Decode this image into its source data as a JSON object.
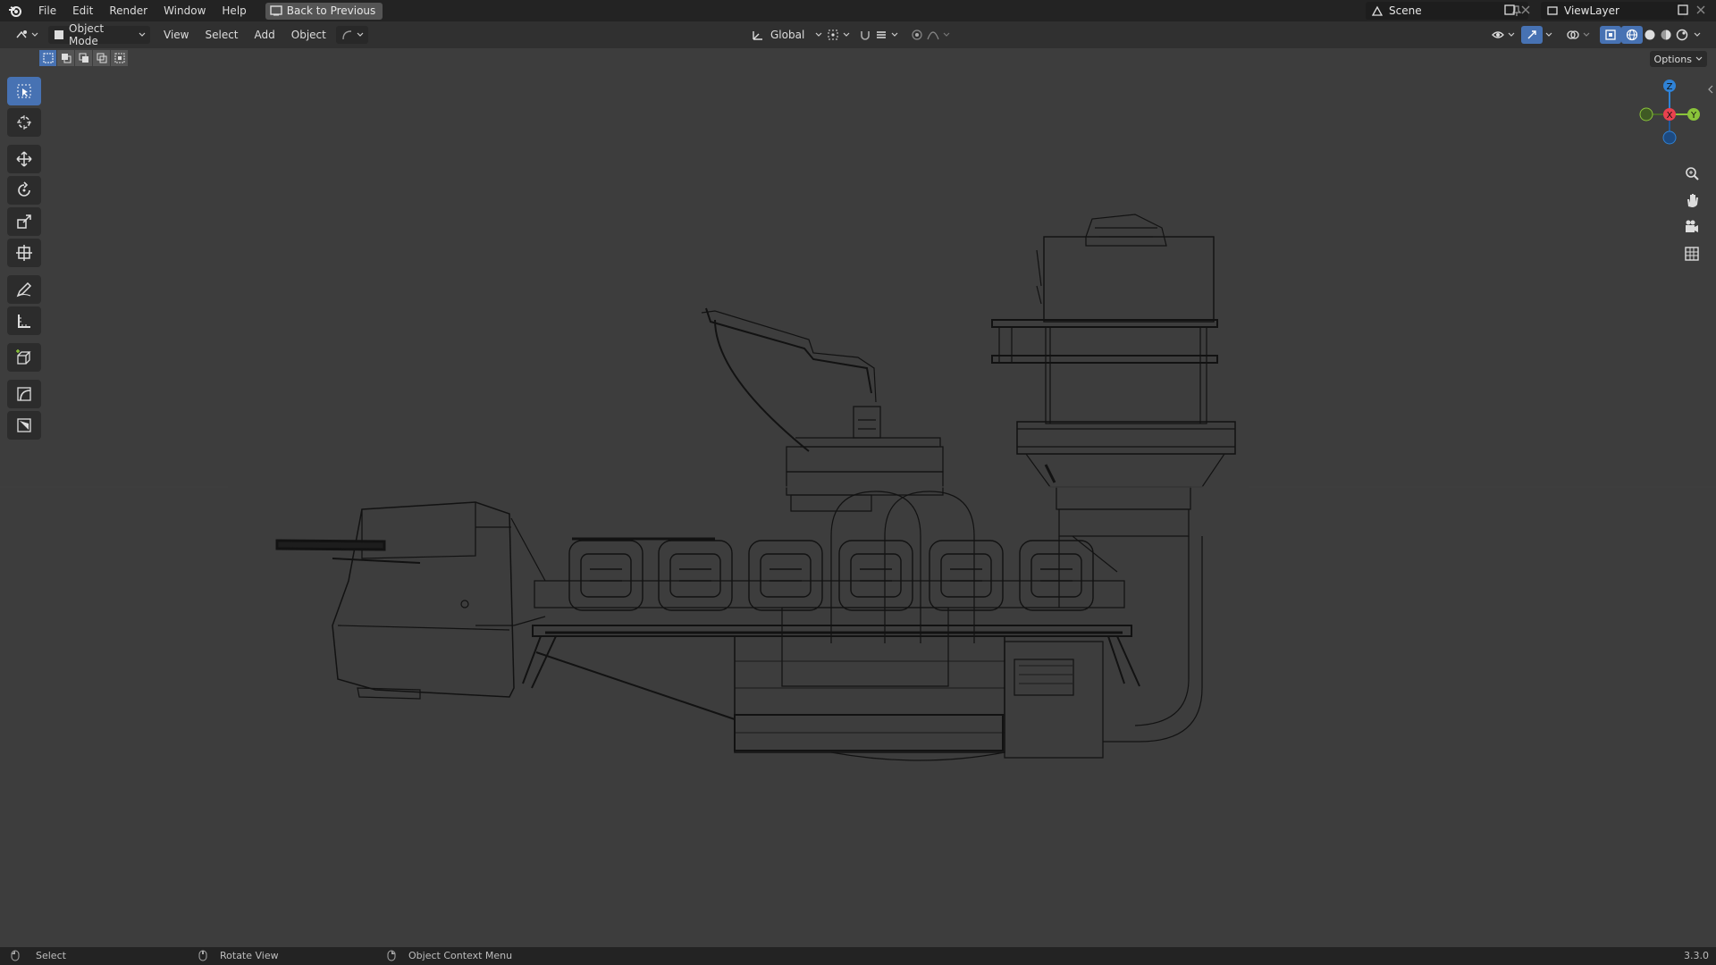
{
  "topbar": {
    "menus": [
      "File",
      "Edit",
      "Render",
      "Window",
      "Help"
    ],
    "back_label": "Back to Previous",
    "scene_name": "Scene",
    "view_layer_name": "ViewLayer"
  },
  "header": {
    "mode_label": "Object Mode",
    "menus": [
      "View",
      "Select",
      "Add",
      "Object"
    ],
    "transform_orientation": "Global",
    "options_label": "Options"
  },
  "gizmo": {
    "axis_z": "Z",
    "axis_y": "Y",
    "axis_x": "X"
  },
  "status": {
    "select_label": "Select",
    "rotate_label": "Rotate View",
    "context_label": "Object Context Menu",
    "version": "3.3.0"
  },
  "colors": {
    "accent": "#4772b3",
    "axis_x": "#e8414e",
    "axis_y": "#8ac43a",
    "axis_z": "#2f82d6",
    "wire": "#0c0c0c"
  }
}
